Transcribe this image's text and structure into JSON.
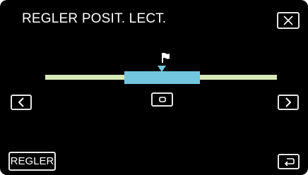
{
  "header": {
    "title": "REGLER POSIT. LECT."
  },
  "icons": {
    "close": "close-x-icon",
    "prev": "chevron-left-icon",
    "next": "chevron-right-icon",
    "center": "square-dot-icon",
    "flag": "flag-icon",
    "marker": "triangle-down-icon",
    "return": "return-arrow-icon"
  },
  "footer": {
    "set_label": "REGLER"
  },
  "colors": {
    "background": "#000000",
    "track": "#d6e8b8",
    "selection": "#72c6de",
    "button_border": "#e6e6e6"
  }
}
